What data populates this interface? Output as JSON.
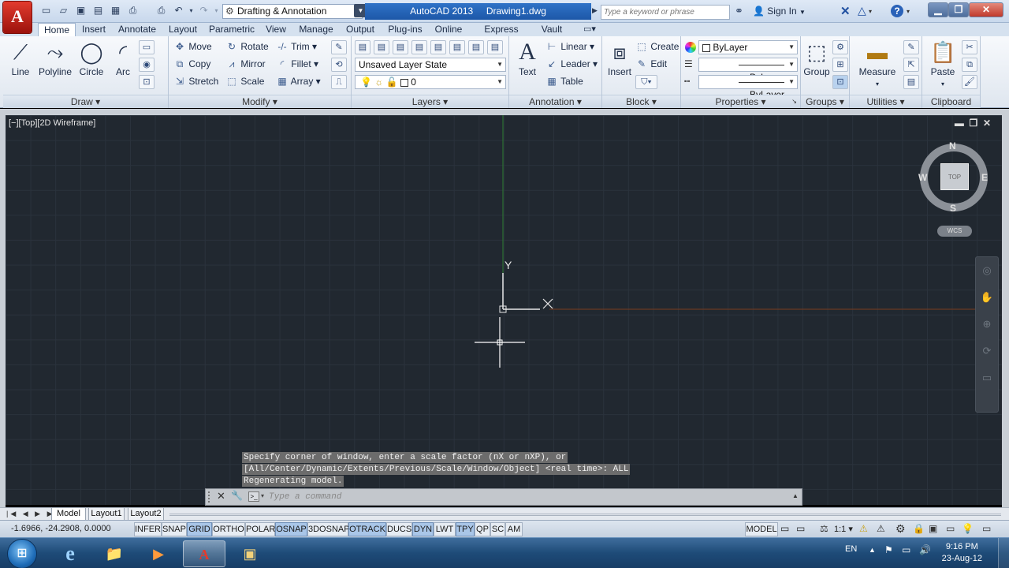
{
  "title_bar": {
    "app_logo": "A",
    "workspace": "Drafting & Annotation",
    "app_title": "AutoCAD 2013",
    "file_name": "Drawing1.dwg",
    "search_placeholder": "Type a keyword or phrase",
    "sign_in": "Sign In",
    "help": "?",
    "win_min": "▁",
    "win_restore": "❐",
    "win_close": "✕"
  },
  "tabs": [
    {
      "label": "Home",
      "active": true
    },
    {
      "label": "Insert"
    },
    {
      "label": "Annotate"
    },
    {
      "label": "Layout"
    },
    {
      "label": "Parametric"
    },
    {
      "label": "View"
    },
    {
      "label": "Manage"
    },
    {
      "label": "Output"
    },
    {
      "label": "Plug-ins"
    },
    {
      "label": "Online"
    },
    {
      "label": "Express Tools"
    },
    {
      "label": "Vault"
    }
  ],
  "ribbon": {
    "draw": {
      "label": "Draw",
      "line": "Line",
      "polyline": "Polyline",
      "circle": "Circle",
      "arc": "Arc"
    },
    "modify": {
      "label": "Modify",
      "move": "Move",
      "rotate": "Rotate",
      "trim": "Trim",
      "copy": "Copy",
      "mirror": "Mirror",
      "fillet": "Fillet",
      "stretch": "Stretch",
      "scale": "Scale",
      "array": "Array"
    },
    "layers": {
      "label": "Layers",
      "layer_state": "Unsaved Layer State",
      "current_layer": "0"
    },
    "annotation": {
      "label": "Annotation",
      "text": "Text",
      "linear": "Linear",
      "leader": "Leader",
      "table": "Table"
    },
    "block": {
      "label": "Block",
      "insert": "Insert",
      "create": "Create",
      "edit": "Edit"
    },
    "properties": {
      "label": "Properties",
      "color": "ByLayer",
      "linetype": "ByLayer",
      "lineweight": "ByLayer"
    },
    "groups": {
      "label": "Groups",
      "group": "Group"
    },
    "utilities": {
      "label": "Utilities",
      "measure": "Measure"
    },
    "clipboard": {
      "label": "Clipboard",
      "paste": "Paste"
    }
  },
  "viewport": {
    "controls": "[−][Top][2D Wireframe]",
    "viewcube": {
      "north": "N",
      "south": "S",
      "east": "E",
      "west": "W",
      "face": "TOP",
      "ucs": "WCS"
    },
    "ucs_y": "Y",
    "ucs_x": "X"
  },
  "command": {
    "history": [
      "Specify corner of window, enter a scale factor (nX or nXP), or",
      "[All/Center/Dynamic/Extents/Previous/Scale/Window/Object] <real time>: ALL",
      "Regenerating model."
    ],
    "placeholder": "Type a command"
  },
  "layout_tabs": [
    {
      "label": "Model",
      "active": true
    },
    {
      "label": "Layout1"
    },
    {
      "label": "Layout2"
    }
  ],
  "status": {
    "coordinates": "-1.6966, -24.2908, 0.0000",
    "toggles": [
      {
        "label": "INFER",
        "on": false
      },
      {
        "label": "SNAP",
        "on": false
      },
      {
        "label": "GRID",
        "on": true
      },
      {
        "label": "ORTHO",
        "on": false
      },
      {
        "label": "POLAR",
        "on": false
      },
      {
        "label": "OSNAP",
        "on": true
      },
      {
        "label": "3DOSNAP",
        "on": false
      },
      {
        "label": "OTRACK",
        "on": true
      },
      {
        "label": "DUCS",
        "on": false
      },
      {
        "label": "DYN",
        "on": true
      },
      {
        "label": "LWT",
        "on": false
      },
      {
        "label": "TPY",
        "on": true
      },
      {
        "label": "QP",
        "on": false
      },
      {
        "label": "SC",
        "on": false
      },
      {
        "label": "AM",
        "on": false
      }
    ],
    "model": "MODEL",
    "anno_scale": "1:1"
  },
  "taskbar": {
    "language": "EN",
    "time": "9:16 PM",
    "date": "23-Aug-12"
  }
}
